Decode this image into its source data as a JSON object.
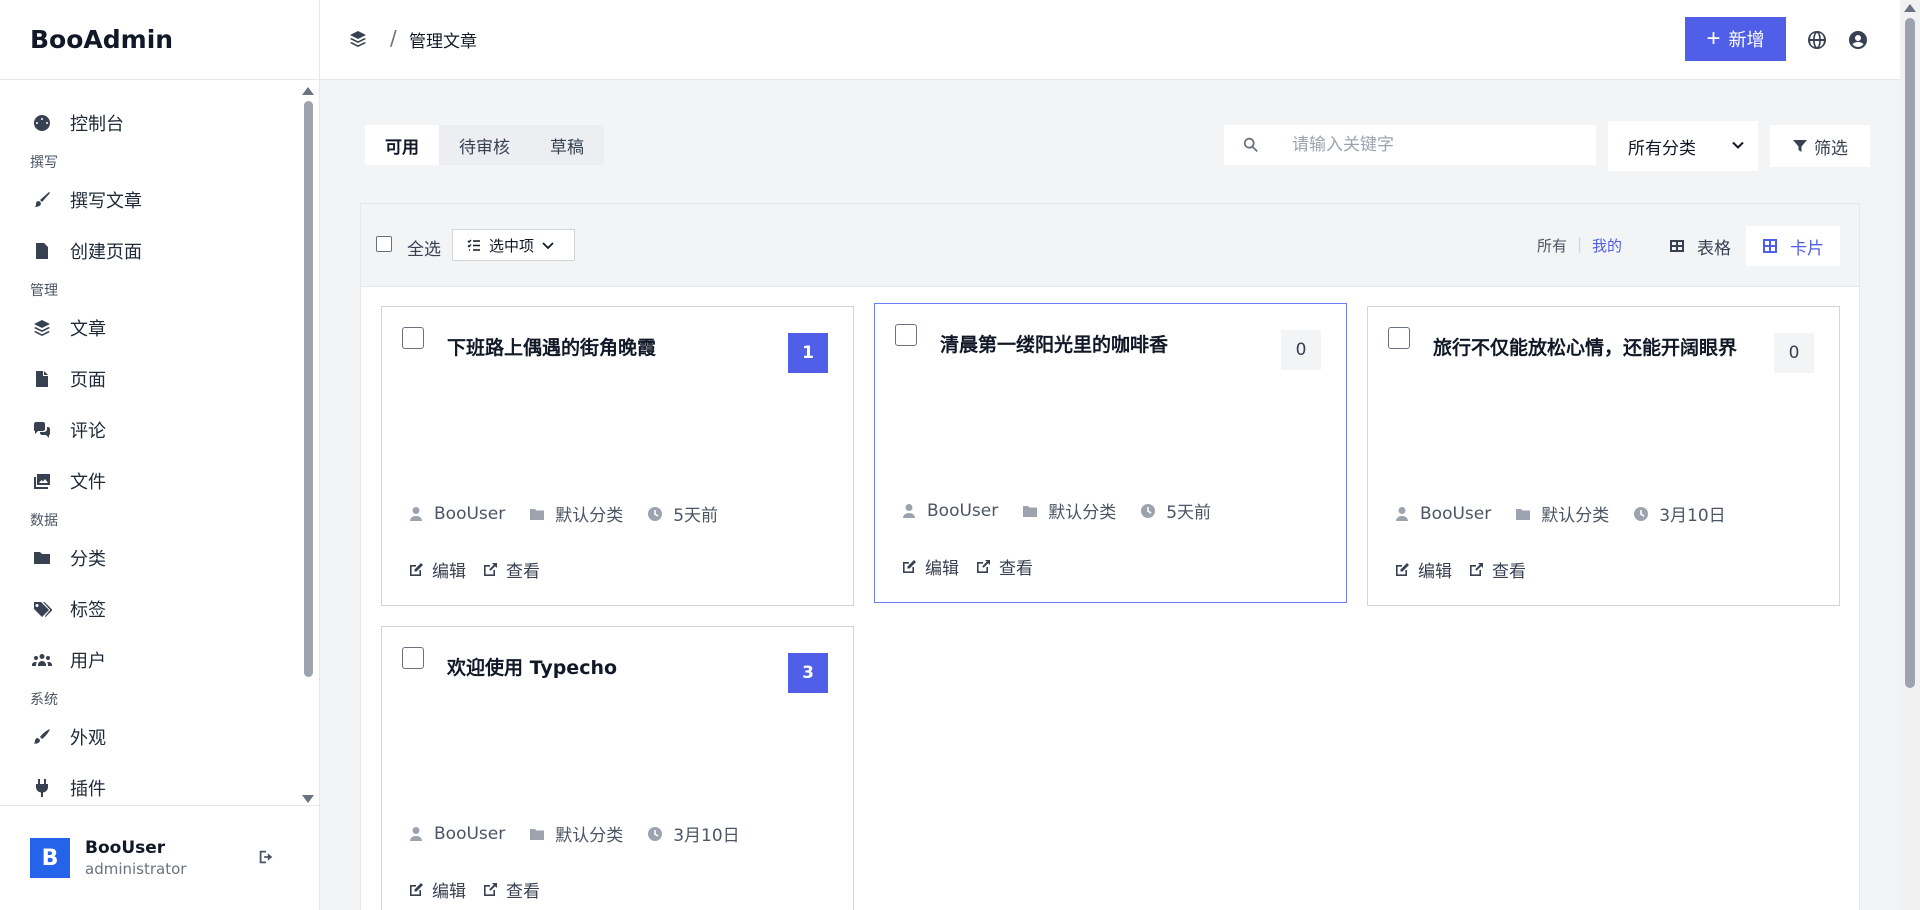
{
  "brand": "BooAdmin",
  "nav": {
    "dashboard": "控制台",
    "sec_write": "撰写",
    "write_post": "撰写文章",
    "create_page": "创建页面",
    "sec_manage": "管理",
    "posts": "文章",
    "pages": "页面",
    "comments": "评论",
    "files": "文件",
    "sec_data": "数据",
    "categories": "分类",
    "tags": "标签",
    "users": "用户",
    "sec_system": "系统",
    "appearance": "外观",
    "plugins": "插件"
  },
  "user": {
    "initial": "B",
    "name": "BooUser",
    "role": "administrator"
  },
  "header": {
    "breadcrumb_sep": "/",
    "title": "管理文章",
    "add_label": "新增",
    "add_icon": "+"
  },
  "tabs": {
    "available": "可用",
    "pending": "待审核",
    "draft": "草稿"
  },
  "search": {
    "placeholder": "请输入关键字",
    "value": ""
  },
  "category_filter": {
    "selected": "所有分类"
  },
  "filter_label": "筛选",
  "toolbar": {
    "select_all": "全选",
    "selected_items": "选中项",
    "scope_all": "所有",
    "scope_divider": "|",
    "scope_mine": "我的",
    "view_table": "表格",
    "view_card": "卡片"
  },
  "posts": [
    {
      "title": "下班路上偶遇的街角晚霞",
      "comments": "1",
      "author": "BooUser",
      "category": "默认分类",
      "time": "5天前",
      "edit": "编辑",
      "view": "查看"
    },
    {
      "title": "清晨第一缕阳光里的咖啡香",
      "comments": "0",
      "author": "BooUser",
      "category": "默认分类",
      "time": "5天前",
      "edit": "编辑",
      "view": "查看"
    },
    {
      "title": "旅行不仅能放松心情，还能开阔眼界",
      "comments": "0",
      "author": "BooUser",
      "category": "默认分类",
      "time": "3月10日",
      "edit": "编辑",
      "view": "查看"
    },
    {
      "title": "欢迎使用 Typecho",
      "comments": "3",
      "author": "BooUser",
      "category": "默认分类",
      "time": "3月10日",
      "edit": "编辑",
      "view": "查看"
    }
  ],
  "colors": {
    "accent": "#4f5fe8",
    "avatar": "#2563eb"
  }
}
